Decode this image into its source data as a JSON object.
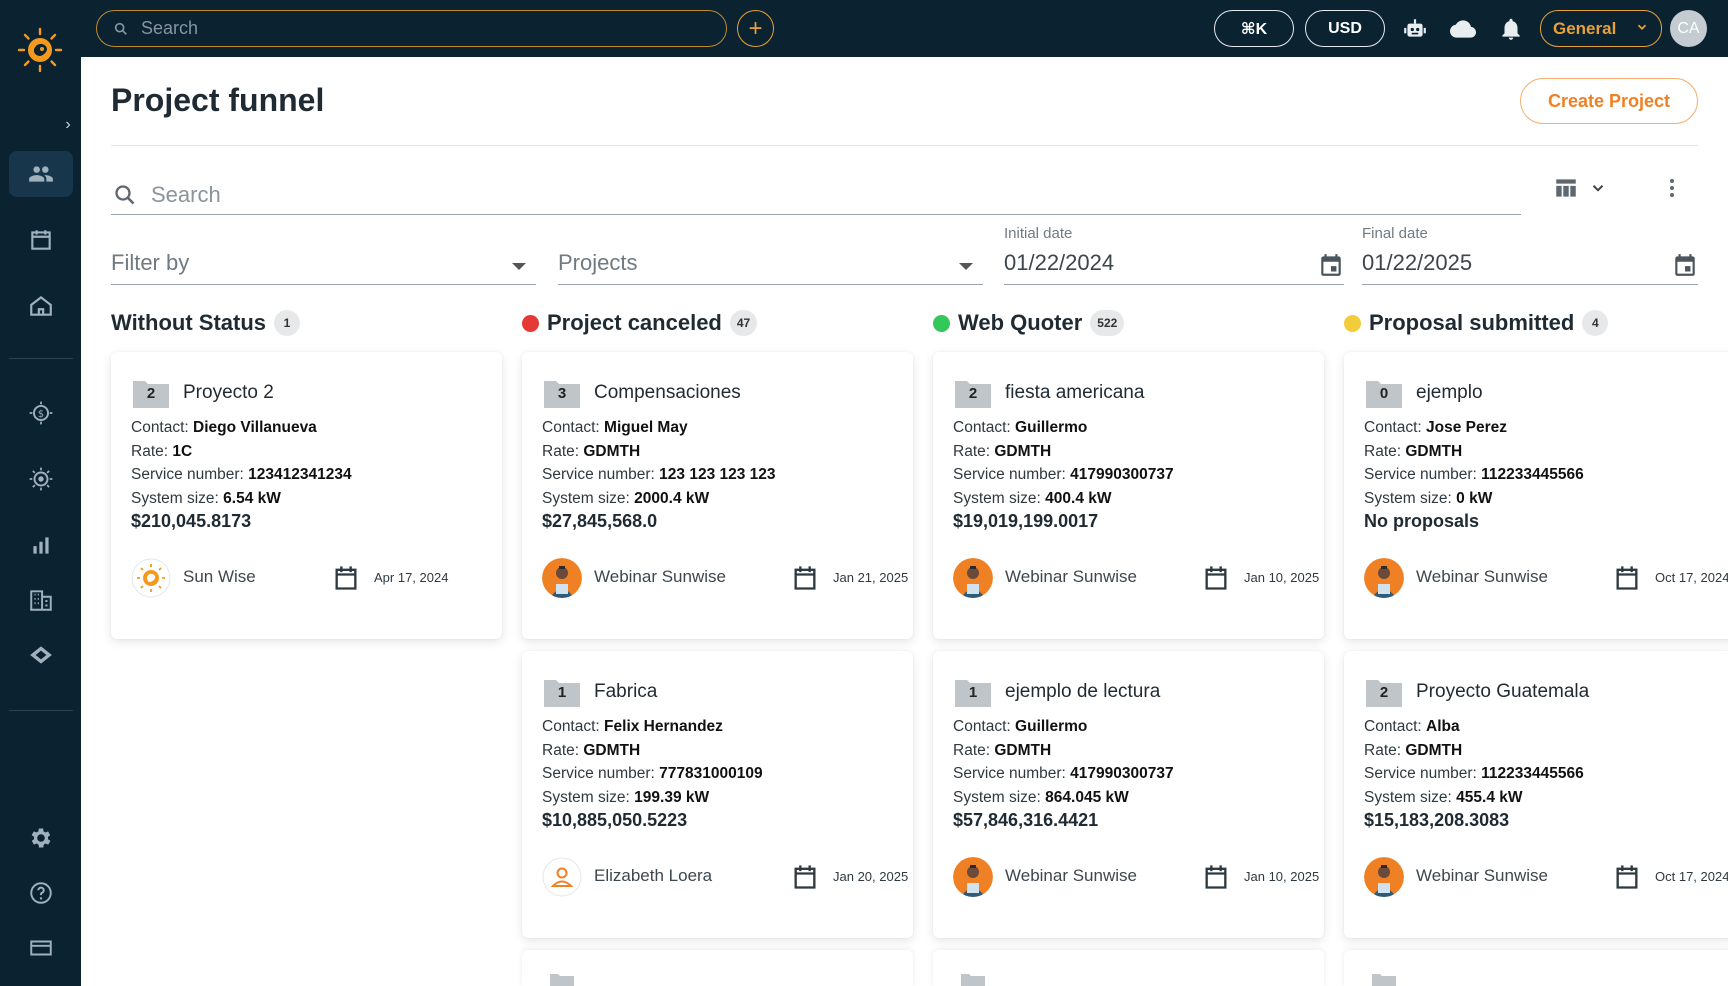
{
  "topbar": {
    "search_placeholder": "Search",
    "shortcut_label": "⌘K",
    "currency_label": "USD",
    "workspace_label": "General",
    "avatar_initials": "CA"
  },
  "header": {
    "title": "Project funnel",
    "create_button": "Create Project"
  },
  "filters": {
    "search_placeholder": "Search",
    "filter_by_placeholder": "Filter by",
    "projects_placeholder": "Projects",
    "initial_date_label": "Initial date",
    "initial_date_value": "01/22/2024",
    "final_date_label": "Final date",
    "final_date_value": "01/22/2025"
  },
  "labels": {
    "contact": "Contact:",
    "rate": "Rate:",
    "service": "Service number:",
    "system": "System size:"
  },
  "columns": [
    {
      "title": "Without Status",
      "count": "1",
      "dot_color": "",
      "cards": [
        {
          "folder": "2",
          "name": "Proyecto 2",
          "contact": "Diego Villanueva",
          "rate": "1C",
          "service": "123412341234",
          "size": "6.54 kW",
          "amount": "$210,045.8173",
          "owner": "Sun Wise",
          "owner_avatar": "logo",
          "date": "Apr 17, 2024"
        }
      ]
    },
    {
      "title": "Project canceled",
      "count": "47",
      "dot_color": "#e53935",
      "cards": [
        {
          "folder": "3",
          "name": "Compensaciones",
          "contact": "Miguel May",
          "rate": "GDMTH",
          "service": "123 123 123 123",
          "size": "2000.4 kW",
          "amount": "$27,845,568.0",
          "owner": "Webinar Sunwise",
          "owner_avatar": "photo",
          "date": "Jan 21, 2025"
        },
        {
          "folder": "1",
          "name": "Fabrica",
          "contact": "Felix Hernandez",
          "rate": "GDMTH",
          "service": "777831000109",
          "size": "199.39 kW",
          "amount": "$10,885,050.5223",
          "owner": "Elizabeth Loera",
          "owner_avatar": "person",
          "date": "Jan 20, 2025"
        }
      ]
    },
    {
      "title": "Web Quoter",
      "count": "522",
      "dot_color": "#34c759",
      "cards": [
        {
          "folder": "2",
          "name": "fiesta americana",
          "contact": "Guillermo",
          "rate": "GDMTH",
          "service": "417990300737",
          "size": "400.4 kW",
          "amount": "$19,019,199.0017",
          "owner": "Webinar Sunwise",
          "owner_avatar": "photo",
          "date": "Jan 10, 2025"
        },
        {
          "folder": "1",
          "name": "ejemplo de lectura",
          "contact": "Guillermo",
          "rate": "GDMTH",
          "service": "417990300737",
          "size": "864.045 kW",
          "amount": "$57,846,316.4421",
          "owner": "Webinar Sunwise",
          "owner_avatar": "photo",
          "date": "Jan 10, 2025"
        }
      ]
    },
    {
      "title": "Proposal submitted",
      "count": "4",
      "dot_color": "#f2cc3a",
      "cards": [
        {
          "folder": "0",
          "name": "ejemplo",
          "contact": "Jose Perez",
          "rate": "GDMTH",
          "service": "112233445566",
          "size": "0 kW",
          "amount": "No proposals",
          "owner": "Webinar Sunwise",
          "owner_avatar": "photo",
          "date": "Oct 17, 2024"
        },
        {
          "folder": "2",
          "name": "Proyecto Guatemala",
          "contact": "Alba",
          "rate": "GDMTH",
          "service": "112233445566",
          "size": "455.4 kW",
          "amount": "$15,183,208.3083",
          "owner": "Webinar Sunwise",
          "owner_avatar": "photo",
          "date": "Oct 17, 2024"
        }
      ]
    }
  ],
  "colors": {
    "sidebar_bg": "#0b2231",
    "accent": "#f08024"
  }
}
